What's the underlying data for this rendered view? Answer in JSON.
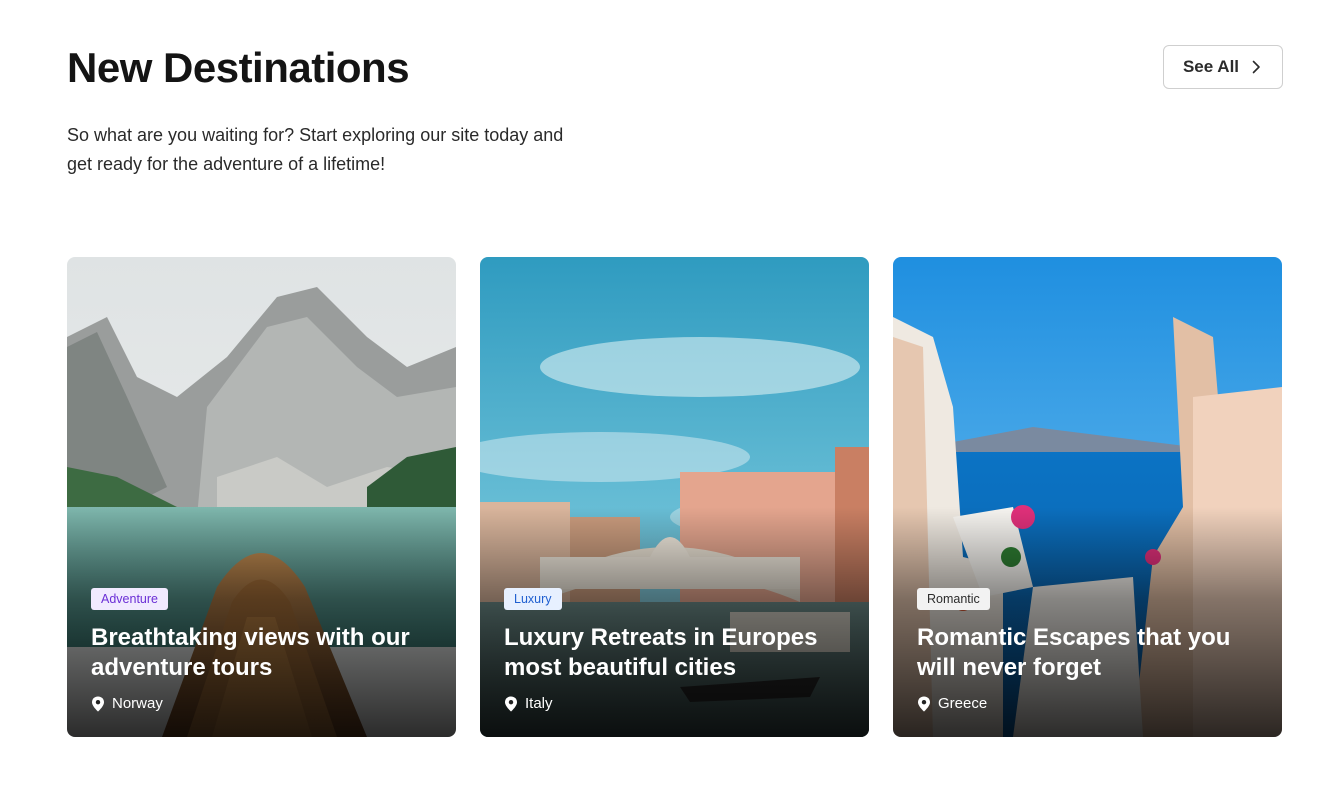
{
  "header": {
    "title": "New Destinations",
    "subtitle": "So what are you waiting for? Start exploring our site today and get ready for the adventure of a lifetime!",
    "see_all_label": "See All"
  },
  "cards": [
    {
      "tag": "Adventure",
      "tag_text_color": "#6b2fd6",
      "tag_bg_color": "#f1eaff",
      "title": "Breathtaking views  with our adventure tours",
      "location": "Norway",
      "image": "mountain-lake-boat-photo"
    },
    {
      "tag": "Luxury",
      "tag_text_color": "#1f5fd0",
      "tag_bg_color": "#e7f0ff",
      "title": "Luxury Retreats in Europes most beautiful cities",
      "location": "Italy",
      "image": "venice-rialto-bridge-photo"
    },
    {
      "tag": "Romantic",
      "tag_text_color": "#2b2b2b",
      "tag_bg_color": "#f2f2f2",
      "title": "Romantic Escapes that you will never forget",
      "location": "Greece",
      "image": "santorini-sea-view-photo"
    }
  ]
}
